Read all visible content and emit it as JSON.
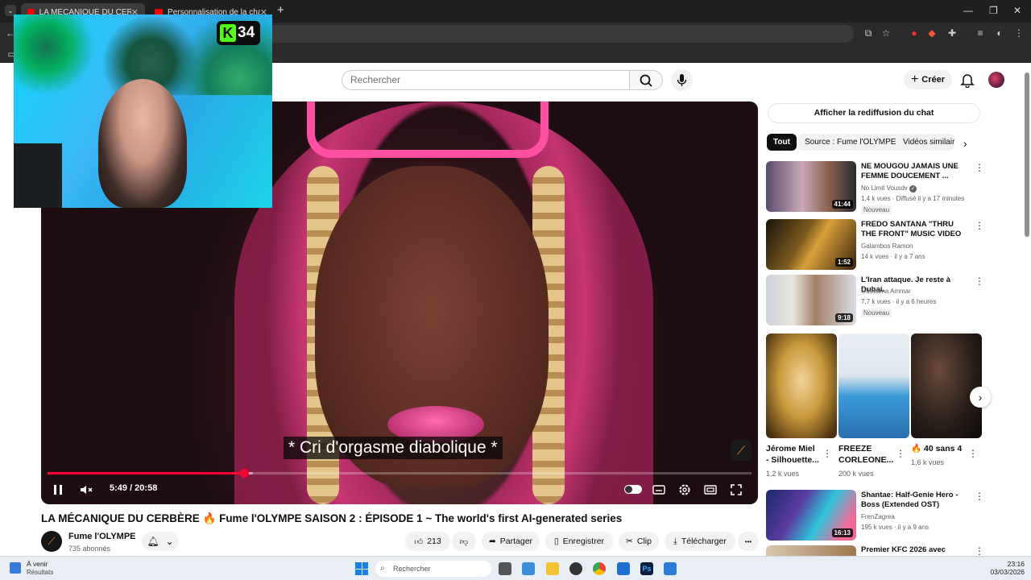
{
  "browser": {
    "tabs": [
      {
        "label": "LA MÉCANIQUE DU CERBÈRE 🔥",
        "close": "✕"
      },
      {
        "label": "Personnalisation de la chaîne -",
        "close": "✕"
      }
    ],
    "new_tab": "+",
    "window_controls": [
      "—",
      "❐",
      "✕"
    ]
  },
  "youtube": {
    "search_placeholder": "Rechercher",
    "create_label": "Créer"
  },
  "webcam": {
    "badge_letter": "K",
    "badge_count": "34"
  },
  "player": {
    "subtitle": "* Cri d'orgasme diabolique *",
    "time": "5:49 / 20:58",
    "progress_played": 0.279,
    "progress_buffered": 0.292
  },
  "video": {
    "title": "LA MÉCANIQUE DU CERBÈRE 🔥 Fume l'OLYMPE SAISON 2 : ÉPISODE 1 ~ The world's first AI-generated series",
    "channel_name": "Fume l'OLYMPE",
    "subscribers": "735 abonnés",
    "likes": "213",
    "share": "Partager",
    "save": "Enregistrer",
    "clip": "Clip",
    "download": "Télécharger",
    "more": "•••"
  },
  "sidebar": {
    "chat_replay": "Afficher la rediffusion du chat",
    "chips": [
      "Tout",
      "Source : Fume l'OLYMPE",
      "Vidéos similaires"
    ],
    "recommendations": [
      {
        "title": "NE MOUGOU JAMAIS UNE FEMME DOUCEMENT ...",
        "channel": "No Limit Vousdv",
        "verified": true,
        "meta": "1,4 k vues · Diffusé il y a 17 minutes",
        "badge": "Nouveau",
        "duration": "41:44"
      },
      {
        "title": "FREDO SANTANA \"THRU THE FRONT\" MUSIC VIDEO",
        "channel": "Galambos Ramon",
        "meta": "14 k vues · il y a 7 ans",
        "badge": "",
        "duration": "1:52"
      },
      {
        "title": "L'Iran attaque. Je reste à Dubai.",
        "channel": "Oussama Ammar",
        "meta": "7,7 k vues · il y a 6 heures",
        "badge": "Nouveau",
        "duration": "9:18"
      }
    ],
    "shorts": [
      {
        "title": "Jérome Miel - Silhouette...",
        "views": "1,2 k vues"
      },
      {
        "title": "FREEZE CORLEONE...",
        "views": "200 k vues"
      },
      {
        "title": "🔥 40 sans 4",
        "views": "1,6 k vues"
      }
    ],
    "more_recommendations": [
      {
        "title": "Shantae: Half-Genie Hero - Boss (Extended OST)",
        "channel": "FrenZagrea",
        "meta": "195 k vues · il y a 9 ans",
        "duration": "16:13"
      },
      {
        "title": "Premier KFC 2026 avec",
        "channel": "",
        "meta": "",
        "duration": ""
      }
    ]
  },
  "taskbar": {
    "weather_title": "À venir",
    "weather_sub": "Résultats",
    "search_placeholder": "Rechercher",
    "time": "23:16",
    "date": "03/03/2026"
  },
  "colors": {
    "youtube_red": "#ff0033",
    "chrome_dark": "#1f1f1f",
    "kick_green": "#53fc18"
  }
}
